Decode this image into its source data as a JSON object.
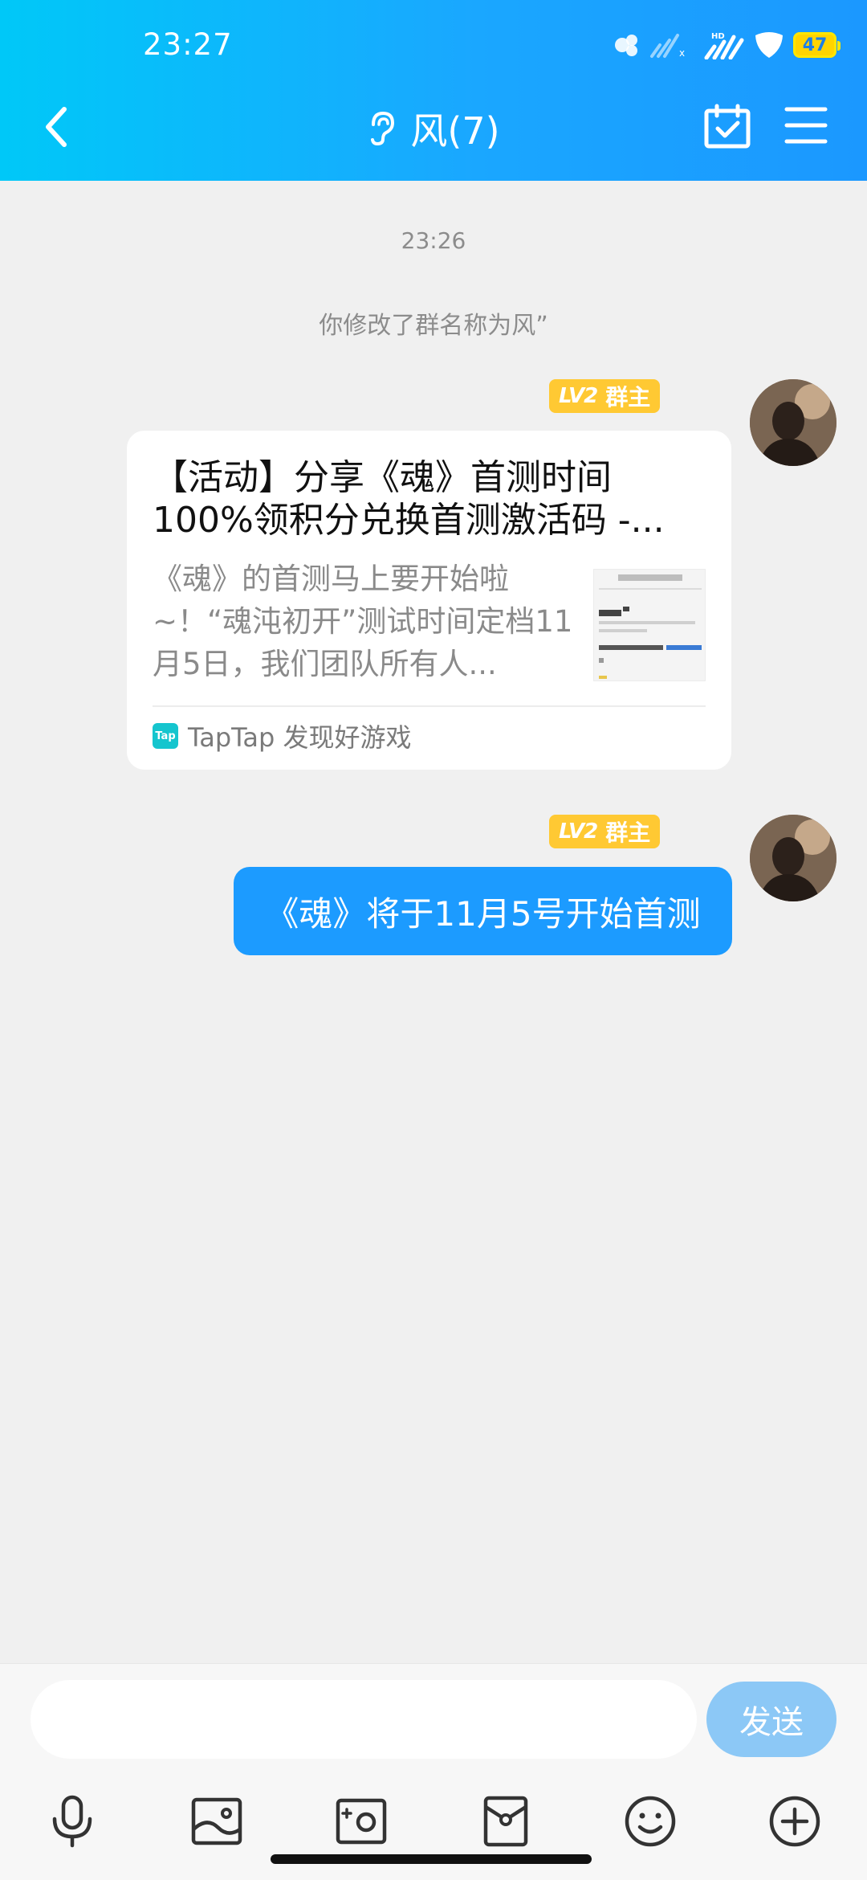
{
  "status_bar": {
    "time": "23:27",
    "battery": "47"
  },
  "header": {
    "title": "风(7)"
  },
  "chat": {
    "system_time": "23:26",
    "system_notice": "你修改了群名称为风”",
    "messages": [
      {
        "type": "link_card",
        "badge": {
          "level": "LV2",
          "role": "群主"
        },
        "card": {
          "title": "【活动】分享《魂》首测时间100%领积分兑换首测激活码 -...",
          "description": "《魂》的首测马上要开始啦~！“魂沌初开”测试时间定档11月5日，我们团队所有人...",
          "source": "TapTap 发现好游戏",
          "source_logo": "Tap"
        }
      },
      {
        "type": "text",
        "badge": {
          "level": "LV2",
          "role": "群主"
        },
        "text": "《魂》将于11月5号开始首测"
      }
    ]
  },
  "input": {
    "value": "",
    "placeholder": "",
    "send_label": "发送"
  },
  "toolbar": [
    "microphone-icon",
    "image-icon",
    "camera-icon",
    "red-packet-icon",
    "emoji-icon",
    "plus-icon"
  ],
  "colors": {
    "header_start": "#00c8f8",
    "header_end": "#1b98ff",
    "bubble": "#1c9bff",
    "badge": "#ffc933",
    "send_disabled": "#8cc8f6"
  }
}
